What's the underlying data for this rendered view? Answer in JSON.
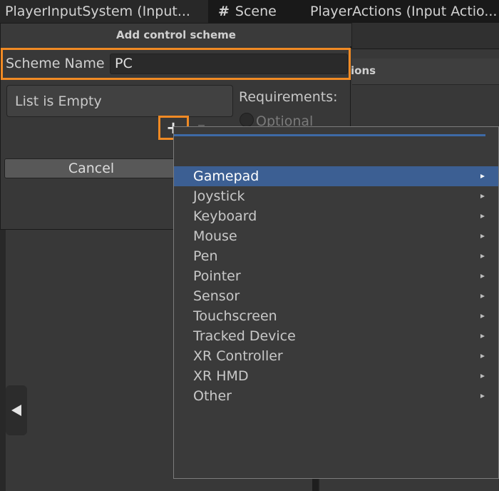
{
  "tabs": [
    {
      "label": "PlayerInputSystem (Input..."
    },
    {
      "label": "Scene",
      "icon": "hash-icon"
    },
    {
      "label": "PlayerActions (Input Actio..."
    }
  ],
  "background": {
    "actions_header": "ions"
  },
  "dialog": {
    "title": "Add control scheme",
    "scheme_name_label": "Scheme Name",
    "scheme_name_value": "PC",
    "list_empty": "List is Empty",
    "requirements_label": "Requirements:",
    "optional_label": "Optional",
    "add_label": "+",
    "remove_label": "–",
    "cancel_label": "Cancel"
  },
  "popup": {
    "items": [
      {
        "label": "Gamepad",
        "selected": true
      },
      {
        "label": "Joystick"
      },
      {
        "label": "Keyboard"
      },
      {
        "label": "Mouse"
      },
      {
        "label": "Pen"
      },
      {
        "label": "Pointer"
      },
      {
        "label": "Sensor"
      },
      {
        "label": "Touchscreen"
      },
      {
        "label": "Tracked Device"
      },
      {
        "label": "XR Controller"
      },
      {
        "label": "XR HMD"
      },
      {
        "label": "Other"
      }
    ]
  },
  "colors": {
    "highlight": "#f08a24",
    "selection": "#3c5f93"
  }
}
